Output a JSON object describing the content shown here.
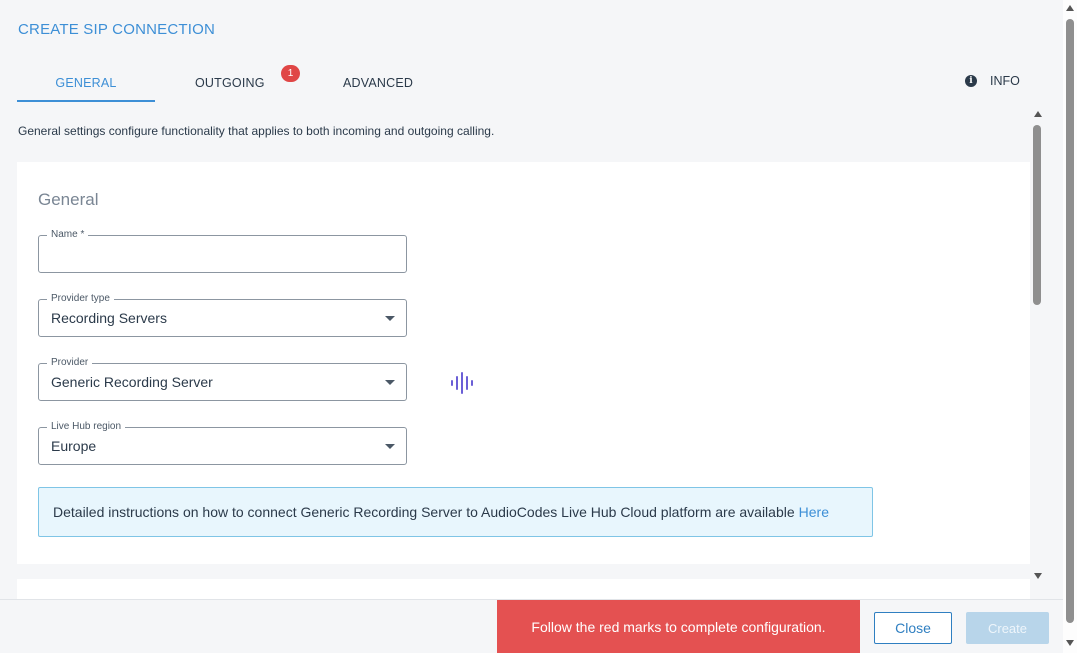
{
  "dialog": {
    "title": "CREATE SIP CONNECTION",
    "description": "General settings configure functionality that applies to both incoming and outgoing calling."
  },
  "tabs": [
    {
      "label": "GENERAL",
      "active": true
    },
    {
      "label": "OUTGOING",
      "badge": "1"
    },
    {
      "label": "ADVANCED"
    }
  ],
  "info": {
    "label": "INFO",
    "icon": "info-icon"
  },
  "general": {
    "section_title": "General",
    "fields": {
      "name": {
        "label": "Name *",
        "value": ""
      },
      "provider_type": {
        "label": "Provider type",
        "value": "Recording Servers"
      },
      "provider": {
        "label": "Provider",
        "value": "Generic Recording Server"
      },
      "region": {
        "label": "Live Hub region",
        "value": "Europe"
      }
    },
    "alert": {
      "text": "Detailed instructions on how to connect Generic Recording Server to AudioCodes Live Hub Cloud platform are available",
      "link": "Here"
    }
  },
  "footer": {
    "toast": "Follow the red marks to complete configuration.",
    "close_label": "Close",
    "create_label": "Create"
  },
  "colors": {
    "accent": "#3d8fd6",
    "error": "#e45151",
    "badge": "#e04646",
    "alert_bg": "#e8f6fd",
    "alert_border": "#7fc5e6",
    "wave_icon": "#6b5fd6"
  }
}
